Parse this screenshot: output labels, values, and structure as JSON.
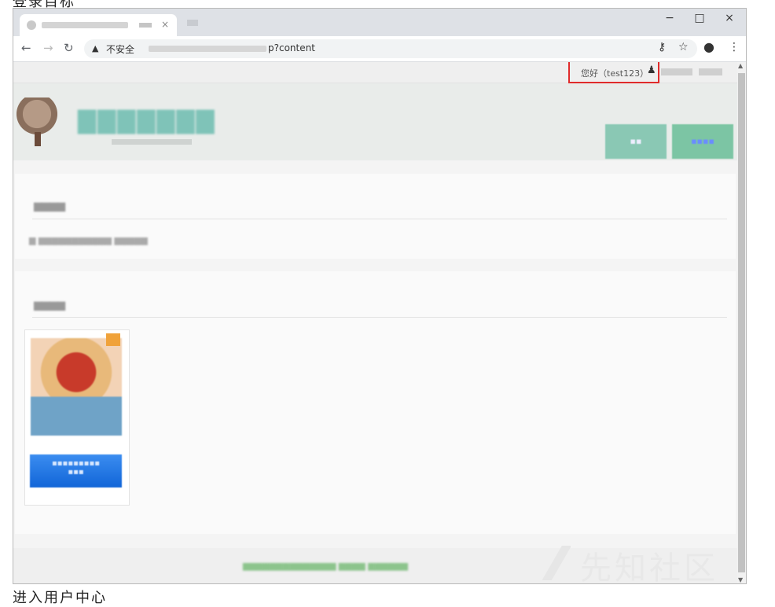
{
  "captions": {
    "top": "登录目标",
    "bottom": "进入用户中心"
  },
  "browser": {
    "tab_close": "×",
    "window_controls": {
      "minimize": "−",
      "maximize": "□",
      "close": "×"
    },
    "nav": {
      "back": "←",
      "forward": "→",
      "reload": "↻"
    },
    "omnibox": {
      "security_icon": "warning-triangle-icon",
      "security_label": "不安全",
      "url_visible_suffix": "p?content"
    },
    "toolbar_icons": {
      "key": "key-icon",
      "star": "star-icon",
      "account": "account-icon",
      "menu": "menu-icon"
    }
  },
  "page": {
    "topbar": {
      "greeting": "您好（test123）"
    },
    "highlight_color": "#e02b2b"
  },
  "watermark": "先知社区"
}
